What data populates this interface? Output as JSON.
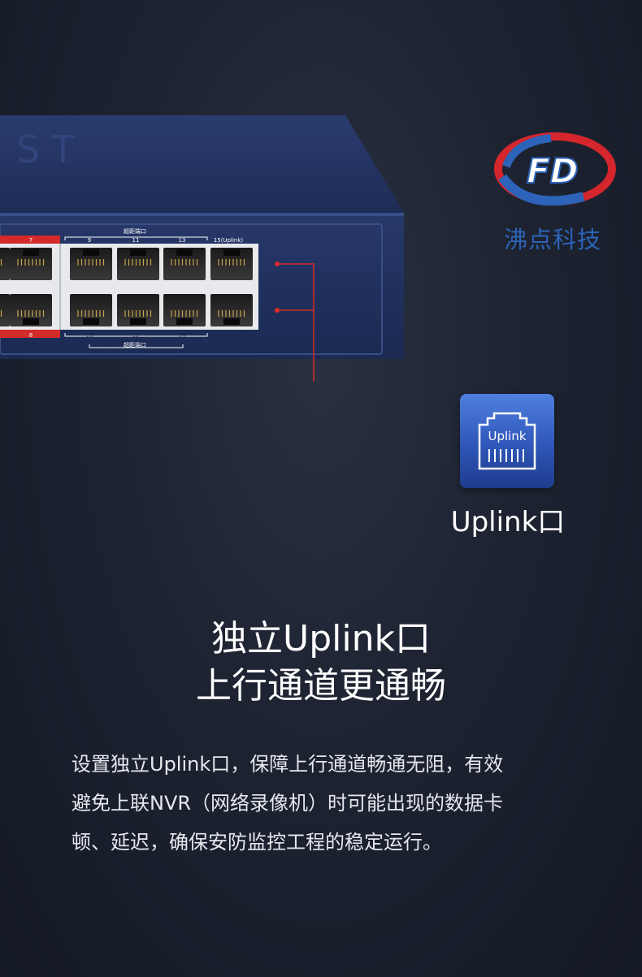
{
  "brand": {
    "logo_letters": "FD",
    "name": "沸点科技",
    "colors": {
      "red": "#d4262c",
      "blue": "#2d63b8"
    }
  },
  "switch": {
    "group_label_top": "超距端口",
    "group_label_bottom": "超距端口",
    "port_labels_top": [
      "7",
      "9",
      "11",
      "13",
      "15(Uplink)"
    ],
    "port_labels_bottom": [
      "8",
      "10",
      "12",
      "14",
      "16(Uplink)"
    ]
  },
  "uplink_badge": {
    "icon_text": "Uplink",
    "icon": "ethernet-port-icon",
    "caption": "Uplink口"
  },
  "headline": {
    "line1": "独立Uplink口",
    "line2": "上行通道更通畅"
  },
  "description": {
    "line1": "设置独立Uplink口，保障上行通道畅通无阻，有效",
    "line2": "避免上联NVR（网络录像机）时可能出现的数据卡",
    "line3": "顿、延迟，确保安防监控工程的稳定运行。"
  }
}
